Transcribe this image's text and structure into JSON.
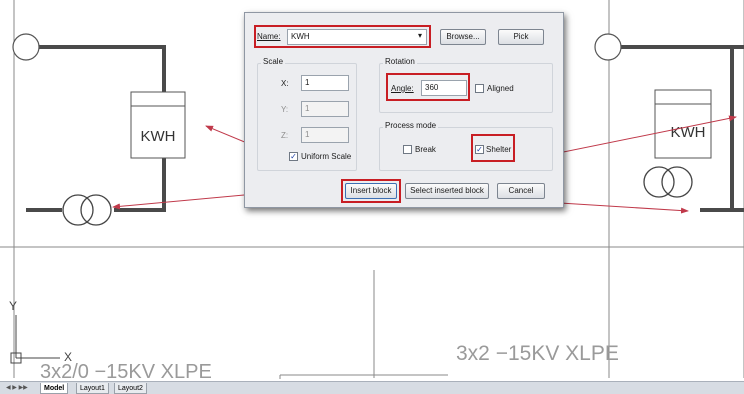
{
  "drawing": {
    "kwh_left": "KWH",
    "kwh_right": "KWH",
    "cable_left": "3x2/0 −15KV XLPE",
    "cable_right": "3x2  −15KV  XLPE",
    "ucs_x": "X",
    "ucs_y": "Y"
  },
  "dialog": {
    "name_label": "Name:",
    "name_value": "KWH",
    "browse_label": "Browse...",
    "pick_label": "Pick",
    "scale": {
      "title": "Scale",
      "x_label": "X:",
      "x_value": "1",
      "y_label": "Y:",
      "y_value": "1",
      "z_label": "Z:",
      "z_value": "1",
      "uniform_label": "Uniform Scale",
      "uniform_checked": true
    },
    "rotation": {
      "title": "Rotation",
      "angle_label": "Angle:",
      "angle_value": "360",
      "aligned_label": "Aligned",
      "aligned_checked": false
    },
    "process_mode": {
      "title": "Process mode",
      "break_label": "Break",
      "break_checked": false,
      "shelter_label": "Shelter",
      "shelter_checked": true
    },
    "insert_label": "Insert block",
    "select_inserted_label": "Select inserted block",
    "cancel_label": "Cancel"
  },
  "tabs": {
    "model": "Model",
    "layout1": "Layout1",
    "layout2": "Layout2"
  },
  "colors": {
    "annotation": "#c81e24",
    "arrow": "#c0394a",
    "wall": "#4a4a4a"
  }
}
